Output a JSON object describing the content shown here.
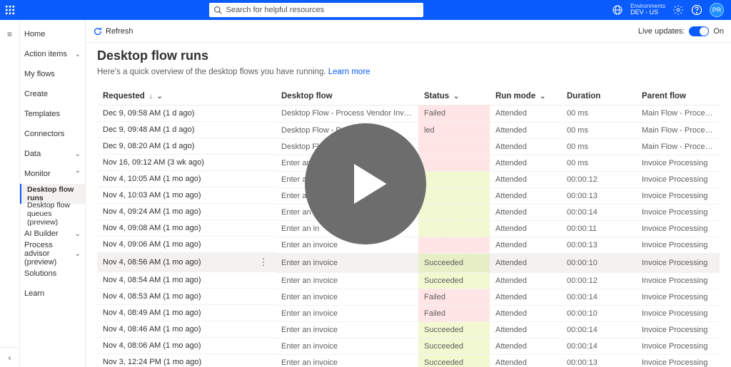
{
  "header": {
    "search_placeholder": "Search for helpful resources",
    "env_label": "Environments",
    "env_value": "DEV - US",
    "avatar_initials": "PR"
  },
  "sidebar": {
    "items": [
      {
        "label": "Home",
        "icon": "home"
      },
      {
        "label": "Action items",
        "icon": "clipboard",
        "expand": true
      },
      {
        "label": "My flows",
        "icon": "flow"
      },
      {
        "label": "Create",
        "icon": "plus"
      },
      {
        "label": "Templates",
        "icon": "template"
      },
      {
        "label": "Connectors",
        "icon": "connector"
      },
      {
        "label": "Data",
        "icon": "data",
        "expand": true
      },
      {
        "label": "Monitor",
        "icon": "monitor",
        "expand": true,
        "open": true
      },
      {
        "label": "Desktop flow runs",
        "sub": true,
        "active": true
      },
      {
        "label": "Desktop flow queues (preview)",
        "sub": true
      },
      {
        "label": "AI Builder",
        "icon": "ai",
        "expand": true
      },
      {
        "label": "Process advisor (preview)",
        "icon": "process",
        "expand": true
      },
      {
        "label": "Solutions",
        "icon": "solutions"
      },
      {
        "label": "Learn",
        "icon": "learn"
      }
    ]
  },
  "commandbar": {
    "refresh": "Refresh",
    "live_label": "Live updates:",
    "live_state": "On"
  },
  "page": {
    "title": "Desktop flow runs",
    "subtitle_prefix": "Here's a quick overview of the desktop flows you have running. ",
    "subtitle_link": "Learn more"
  },
  "columns": {
    "requested": "Requested",
    "flow": "Desktop flow",
    "status": "Status",
    "mode": "Run mode",
    "duration": "Duration",
    "parent": "Parent flow"
  },
  "rows": [
    {
      "requested": "Dec 9, 09:58 AM (1 d ago)",
      "flow": "Desktop Flow - Process Vendor Invoices",
      "status": "Failed",
      "sc": "failed",
      "mode": "Attended",
      "duration": "00 ms",
      "parent": "Main Flow - Process AI Builder Docu..."
    },
    {
      "requested": "Dec 9, 09:48 AM (1 d ago)",
      "flow": "Desktop Flow - Proces",
      "status": "led",
      "sc": "failed",
      "mode": "Attended",
      "duration": "00 ms",
      "parent": "Main Flow - Process AI Builder Docu..."
    },
    {
      "requested": "Dec 9, 08:20 AM (1 d ago)",
      "flow": "Desktop Flow - ",
      "status": "",
      "sc": "failed",
      "mode": "Attended",
      "duration": "00 ms",
      "parent": "Main Flow - Process AI Builder Docu..."
    },
    {
      "requested": "Nov 16, 09:12 AM (3 wk ago)",
      "flow": "Enter an in",
      "status": "",
      "sc": "failed",
      "mode": "Attended",
      "duration": "00 ms",
      "parent": "Invoice Processing"
    },
    {
      "requested": "Nov 4, 10:05 AM (1 mo ago)",
      "flow": "Enter an",
      "status": "",
      "sc": "succeeded",
      "mode": "Attended",
      "duration": "00:00:12",
      "parent": "Invoice Processing"
    },
    {
      "requested": "Nov 4, 10:03 AM (1 mo ago)",
      "flow": "Enter an",
      "status": "",
      "sc": "succeeded",
      "mode": "Attended",
      "duration": "00:00:13",
      "parent": "Invoice Processing"
    },
    {
      "requested": "Nov 4, 09:24 AM (1 mo ago)",
      "flow": "Enter an",
      "status": "",
      "sc": "succeeded",
      "mode": "Attended",
      "duration": "00:00:14",
      "parent": "Invoice Processing"
    },
    {
      "requested": "Nov 4, 09:08 AM (1 mo ago)",
      "flow": "Enter an in",
      "status": "",
      "sc": "succeeded",
      "mode": "Attended",
      "duration": "00:00:11",
      "parent": "Invoice Processing"
    },
    {
      "requested": "Nov 4, 09:06 AM (1 mo ago)",
      "flow": "Enter an invoice",
      "status": "",
      "sc": "failed",
      "mode": "Attended",
      "duration": "00:00:13",
      "parent": "Invoice Processing"
    },
    {
      "requested": "Nov 4, 08:56 AM (1 mo ago)",
      "flow": "Enter an invoice",
      "status": "Succeeded",
      "sc": "succeeded",
      "mode": "Attended",
      "duration": "00:00:10",
      "parent": "Invoice Processing",
      "hovered": true
    },
    {
      "requested": "Nov 4, 08:54 AM (1 mo ago)",
      "flow": "Enter an invoice",
      "status": "Succeeded",
      "sc": "succeeded",
      "mode": "Attended",
      "duration": "00:00:12",
      "parent": "Invoice Processing"
    },
    {
      "requested": "Nov 4, 08:53 AM (1 mo ago)",
      "flow": "Enter an invoice",
      "status": "Failed",
      "sc": "failed",
      "mode": "Attended",
      "duration": "00:00:14",
      "parent": "Invoice Processing"
    },
    {
      "requested": "Nov 4, 08:49 AM (1 mo ago)",
      "flow": "Enter an invoice",
      "status": "Failed",
      "sc": "failed",
      "mode": "Attended",
      "duration": "00:00:10",
      "parent": "Invoice Processing"
    },
    {
      "requested": "Nov 4, 08:46 AM (1 mo ago)",
      "flow": "Enter an invoice",
      "status": "Succeeded",
      "sc": "succeeded",
      "mode": "Attended",
      "duration": "00:00:14",
      "parent": "Invoice Processing"
    },
    {
      "requested": "Nov 4, 08:06 AM (1 mo ago)",
      "flow": "Enter an invoice",
      "status": "Succeeded",
      "sc": "succeeded",
      "mode": "Attended",
      "duration": "00:00:14",
      "parent": "Invoice Processing"
    },
    {
      "requested": "Nov 3, 12:24 PM (1 mo ago)",
      "flow": "Enter an invoice",
      "status": "Succeeded",
      "sc": "succeeded",
      "mode": "Attended",
      "duration": "00:00:13",
      "parent": "Invoice Processing"
    }
  ]
}
